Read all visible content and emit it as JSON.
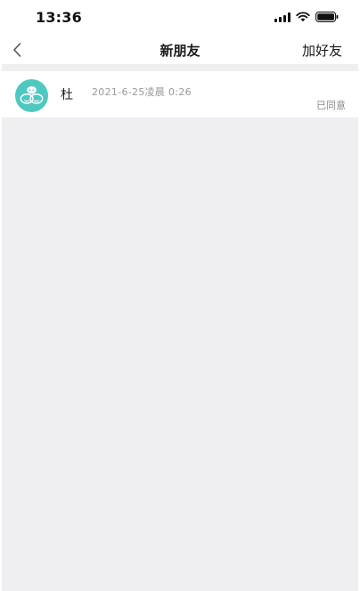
{
  "status_bar": {
    "time": "13:36",
    "icons": [
      "cellular-signal-icon",
      "wifi-icon",
      "battery-icon"
    ]
  },
  "nav": {
    "back_icon": "chevron-left-icon",
    "title": "新朋友",
    "right_action": "加好友"
  },
  "requests": [
    {
      "avatar_icon": "teal-chat-bubbles-avatar",
      "name": "杜",
      "time": "2021-6-25凌晨 0:26",
      "status": "已同意"
    }
  ],
  "colors": {
    "background": "#efeff1",
    "surface": "#ffffff",
    "avatar_teal": "#4fc8c0",
    "text_primary": "#1a1a1a",
    "text_secondary": "#9a9a9a"
  }
}
